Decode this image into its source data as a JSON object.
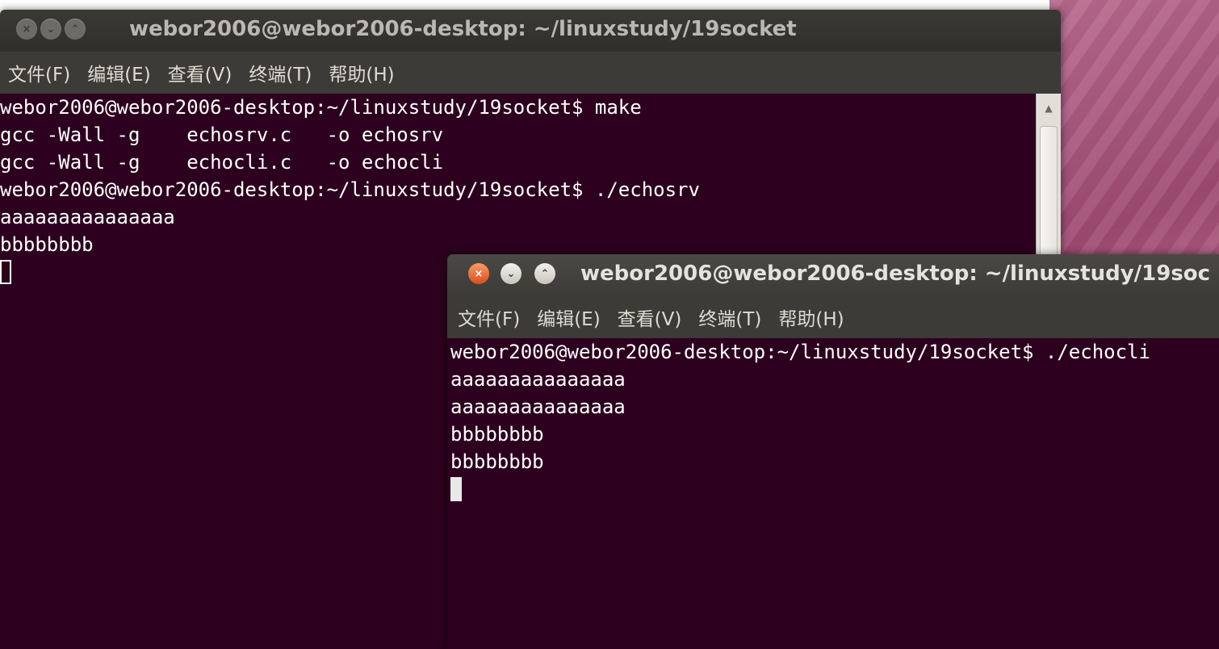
{
  "window1": {
    "title": "webor2006@webor2006-desktop: ~/linuxstudy/19socket",
    "buttons": {
      "close": "×",
      "minimize": "⌄",
      "maximize": "⌃"
    },
    "menu": [
      "文件(F)",
      "编辑(E)",
      "查看(V)",
      "终端(T)",
      "帮助(H)"
    ],
    "lines": [
      "webor2006@webor2006-desktop:~/linuxstudy/19socket$ make",
      "gcc -Wall -g    echosrv.c   -o echosrv",
      "gcc -Wall -g    echocli.c   -o echocli",
      "webor2006@webor2006-desktop:~/linuxstudy/19socket$ ./echosrv",
      "aaaaaaaaaaaaaaa",
      "bbbbbbbb"
    ],
    "scroll_up_icon": "▲"
  },
  "window2": {
    "title": "webor2006@webor2006-desktop: ~/linuxstudy/19soc",
    "buttons": {
      "close": "×",
      "minimize": "⌄",
      "maximize": "⌃"
    },
    "menu": [
      "文件(F)",
      "编辑(E)",
      "查看(V)",
      "终端(T)",
      "帮助(H)"
    ],
    "lines": [
      "webor2006@webor2006-desktop:~/linuxstudy/19socket$ ./echocli",
      "aaaaaaaaaaaaaaa",
      "aaaaaaaaaaaaaaa",
      "bbbbbbbb",
      "bbbbbbbb"
    ]
  },
  "colors": {
    "terminal_bg": "#2c001e",
    "titlebar": "#3c3b37",
    "close_button": "#dc4d18"
  }
}
